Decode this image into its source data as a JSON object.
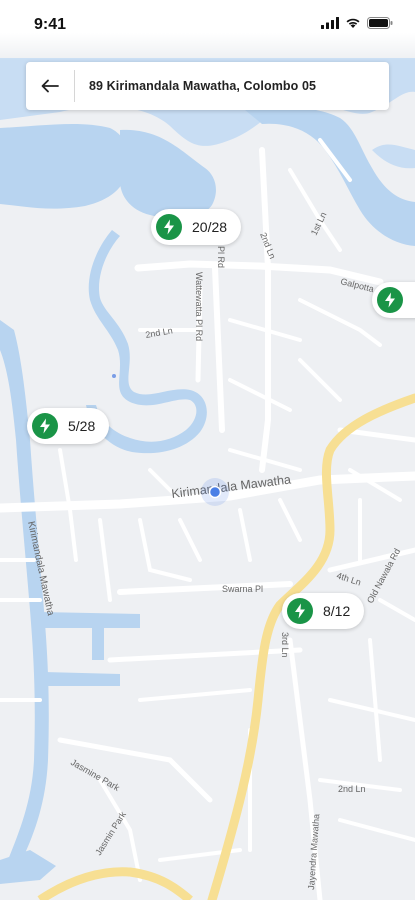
{
  "status_bar": {
    "time": "9:41"
  },
  "search": {
    "address": "89 Kirimandala Mawatha, Colombo 05"
  },
  "stations": [
    {
      "availability": "20/28"
    },
    {
      "availability": "5/28"
    },
    {
      "availability": "8/12"
    },
    {
      "availability": ""
    }
  ],
  "map": {
    "street_labels": {
      "kirimandala": "Kirimandala Mawatha",
      "kirimandala_vertical": "Kirimandala Mawatha",
      "wattewatta": "Wattewatta Pl Rd",
      "second_ln_top": "2nd Ln",
      "second_ln_mid": "2nd Ln",
      "second_ln_bottom": "2nd Ln",
      "galpotta": "Galpotta",
      "swarna": "Swarna Pl",
      "fourth_ln": "4th Ln",
      "old_nawala": "Old Nawala Rd",
      "jasmine_park": "Jasmine Park",
      "jasmin_park": "Jasmin Park",
      "mendra": "Jayendra Mawatha",
      "first_ln": "1st Ln",
      "third_ln": "3rd Ln",
      "first_ln_b": "1st Ln",
      "pl_rd": "Pl Rd"
    },
    "colors": {
      "water": "#b8d4f0",
      "road": "#ffffff",
      "main_road": "#f7df93",
      "land": "#eef0f3",
      "station_green": "#1a9447",
      "location_dot": "#4a7fe6"
    }
  }
}
